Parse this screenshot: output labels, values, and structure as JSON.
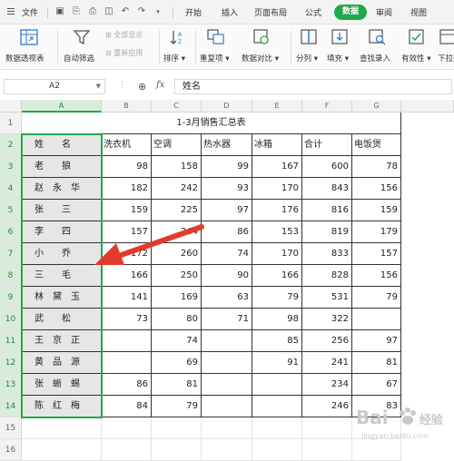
{
  "menubar": {
    "file": "文件",
    "tabs": [
      "开始",
      "插入",
      "页面布局",
      "公式",
      "数据",
      "审阅",
      "视图"
    ],
    "active_tab": "数据"
  },
  "ribbon": {
    "pivot_table": "数据透视表",
    "auto_filter": "自动筛选",
    "show_all": "全部显示",
    "reapply": "重新应用",
    "sort": "排序",
    "duplicates": "重复项",
    "compare": "数据对比",
    "split": "分列",
    "fill": "填充",
    "lookup_entry": "查找录入",
    "validity": "有效性",
    "dropdown_list": "下拉列表"
  },
  "formula_bar": {
    "name_box": "A2",
    "fx": "fx",
    "content": "姓名"
  },
  "columns": [
    "A",
    "B",
    "C",
    "D",
    "E",
    "F",
    "G"
  ],
  "rows": [
    "1",
    "2",
    "3",
    "4",
    "5",
    "6",
    "7",
    "8",
    "9",
    "10",
    "11",
    "12",
    "13",
    "14",
    "15",
    "16"
  ],
  "sheet": {
    "title": "1-3月销售汇总表",
    "headers": [
      "姓　　名",
      "洗衣机",
      "空调",
      "热水器",
      "冰箱",
      "合计",
      "电饭煲"
    ],
    "data": [
      [
        "老　　狼",
        "98",
        "158",
        "99",
        "167",
        "600",
        "78"
      ],
      [
        "赵　永　华",
        "182",
        "242",
        "93",
        "170",
        "843",
        "156"
      ],
      [
        "张　　三",
        "159",
        "225",
        "97",
        "176",
        "816",
        "159"
      ],
      [
        "李　　四",
        "157",
        "244",
        "86",
        "153",
        "819",
        "179"
      ],
      [
        "小　　乔",
        "172",
        "260",
        "74",
        "170",
        "833",
        "157"
      ],
      [
        "三　　毛",
        "166",
        "250",
        "90",
        "166",
        "828",
        "156"
      ],
      [
        "林　黛　玉",
        "141",
        "169",
        "63",
        "79",
        "531",
        "79"
      ],
      [
        "武　　松",
        "73",
        "80",
        "71",
        "98",
        "322",
        ""
      ],
      [
        "王　京　正",
        "",
        "74",
        "",
        "85",
        "256",
        "97"
      ],
      [
        "黄　品　源",
        "",
        "69",
        "",
        "91",
        "241",
        "81"
      ],
      [
        "张　蜥　蜴",
        "86",
        "81",
        "",
        "",
        "234",
        "67"
      ],
      [
        "陈　红　梅",
        "84",
        "79",
        "",
        "",
        "246",
        "83"
      ]
    ]
  },
  "watermark": {
    "brand": "Bai",
    "brand2": "经验",
    "url": "jingyan.baidu.com"
  },
  "colors": {
    "accent": "#22a84a",
    "arrow": "#e23b2e"
  }
}
